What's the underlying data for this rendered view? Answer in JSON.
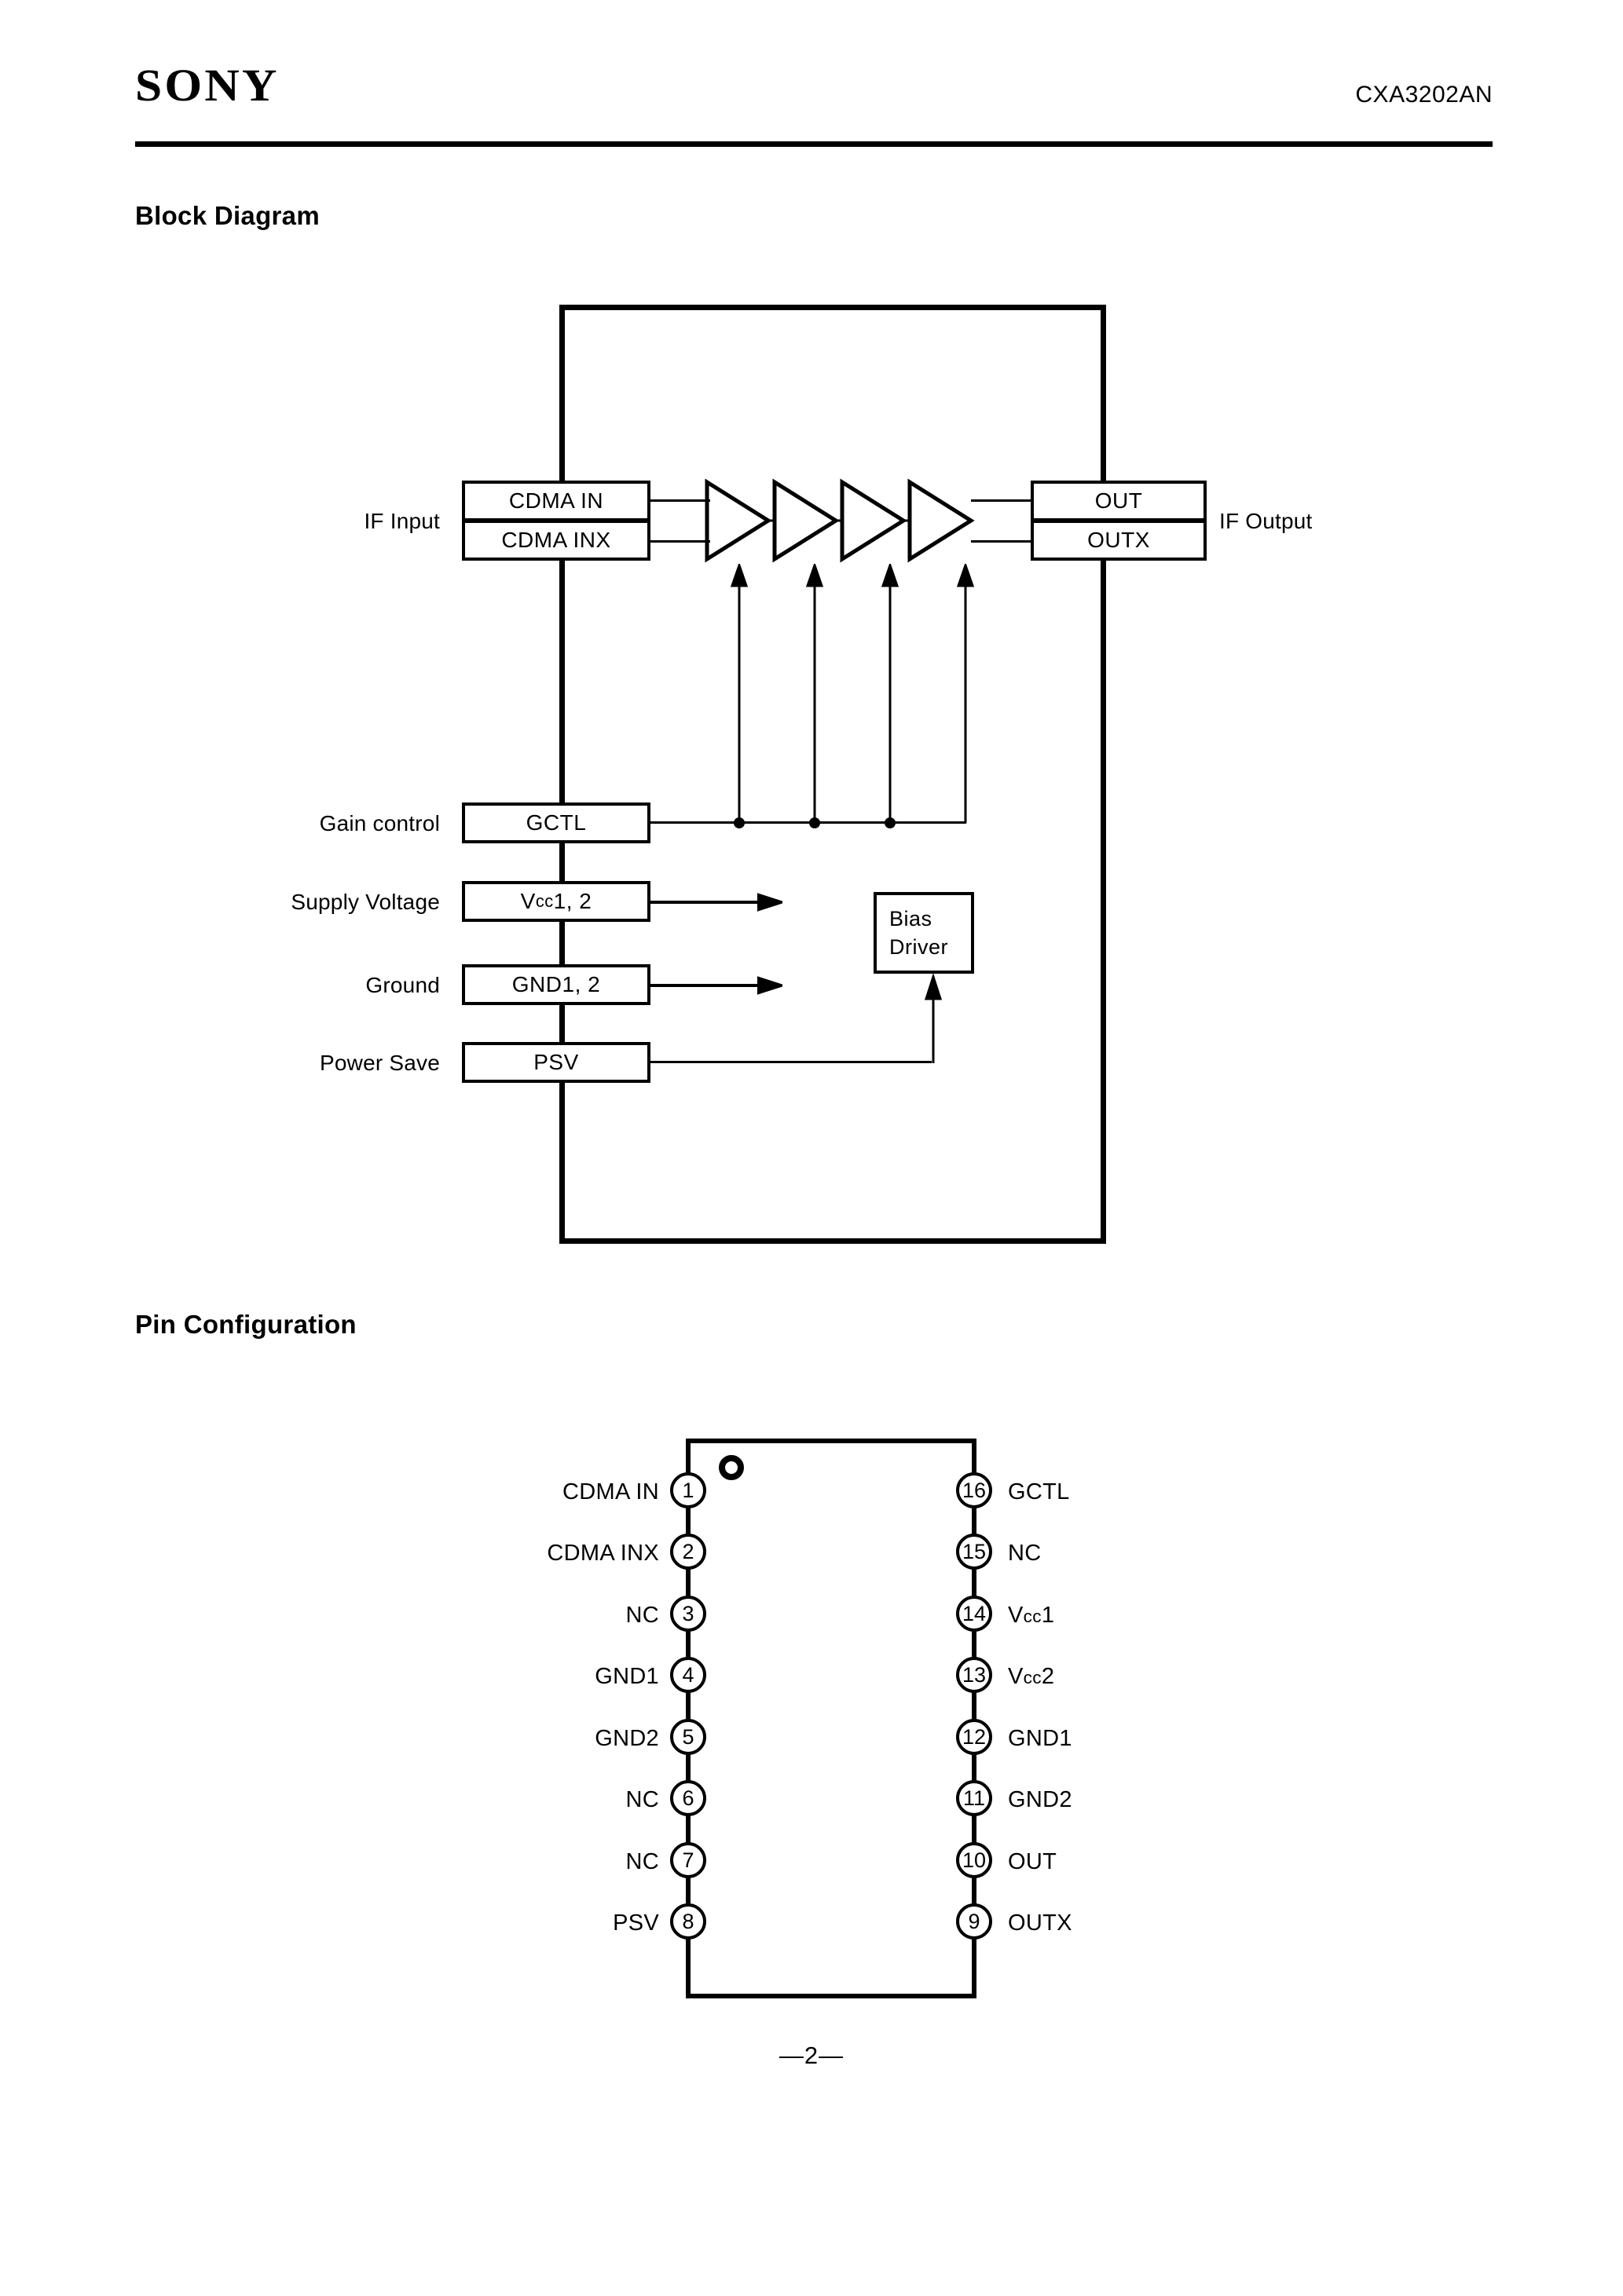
{
  "header": {
    "logo": "SONY",
    "part_number": "CXA3202AN"
  },
  "sections": {
    "block_diagram_title": "Block Diagram",
    "pin_configuration_title": "Pin Configuration"
  },
  "block_diagram": {
    "input_label": "IF Input",
    "output_label": "IF Output",
    "blocks": {
      "cdma_in": "CDMA IN",
      "cdma_inx": "CDMA INX",
      "out": "OUT",
      "outx": "OUTX",
      "gctl": "GCTL",
      "vcc": "Vcc1, 2",
      "vcc_prefix": "V",
      "vcc_sub": "cc",
      "vcc_suffix": "1, 2",
      "gnd": "GND1, 2",
      "psv": "PSV",
      "bias_line1": "Bias",
      "bias_line2": "Driver"
    },
    "side_labels": {
      "gain_control": "Gain control",
      "supply_voltage": "Supply Voltage",
      "ground": "Ground",
      "power_save": "Power Save"
    },
    "amplifier_count": 4,
    "gain_control_tap_count": 4
  },
  "pin_configuration": {
    "pin1_marker": "pin1-indicator-circle",
    "left_pins": [
      {
        "number": "1",
        "name": "CDMA IN"
      },
      {
        "number": "2",
        "name": "CDMA INX"
      },
      {
        "number": "3",
        "name": "NC"
      },
      {
        "number": "4",
        "name": "GND1"
      },
      {
        "number": "5",
        "name": "GND2"
      },
      {
        "number": "6",
        "name": "NC"
      },
      {
        "number": "7",
        "name": "NC"
      },
      {
        "number": "8",
        "name": "PSV"
      }
    ],
    "right_pins": [
      {
        "number": "16",
        "name": "GCTL"
      },
      {
        "number": "15",
        "name": "NC"
      },
      {
        "number": "14",
        "name": "Vcc1",
        "prefix": "V",
        "sub": "cc",
        "suffix": "1"
      },
      {
        "number": "13",
        "name": "Vcc2",
        "prefix": "V",
        "sub": "cc",
        "suffix": "2"
      },
      {
        "number": "12",
        "name": "GND1"
      },
      {
        "number": "11",
        "name": "GND2"
      },
      {
        "number": "10",
        "name": "OUT"
      },
      {
        "number": "9",
        "name": "OUTX"
      }
    ]
  },
  "footer": {
    "page": "—2—"
  },
  "colors": {
    "ink": "#000000",
    "paper": "#ffffff"
  }
}
